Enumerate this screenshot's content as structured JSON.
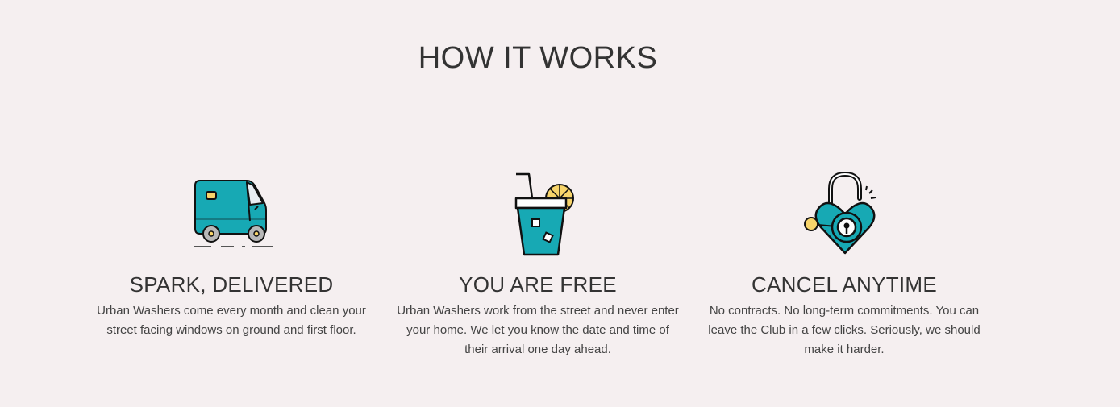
{
  "section": {
    "title": "HOW IT WORKS"
  },
  "colors": {
    "background": "#f5eff0",
    "accent_teal": "#17a9b4",
    "accent_yellow": "#f7d46a",
    "text": "#333333"
  },
  "features": [
    {
      "icon": "van-icon",
      "title": "SPARK, DELIVERED",
      "description": "Urban Washers come every month and clean your street facing windows on ground and first floor."
    },
    {
      "icon": "drink-icon",
      "title": "YOU ARE FREE",
      "description": "Urban Washers work from the street and never enter your home. We let you know the date and time of their arrival one day ahead."
    },
    {
      "icon": "heart-lock-icon",
      "title": "CANCEL ANYTIME",
      "description": "No contracts. No long-term commitments. You can leave the Club in a few clicks. Seriously, we should make it harder."
    }
  ]
}
